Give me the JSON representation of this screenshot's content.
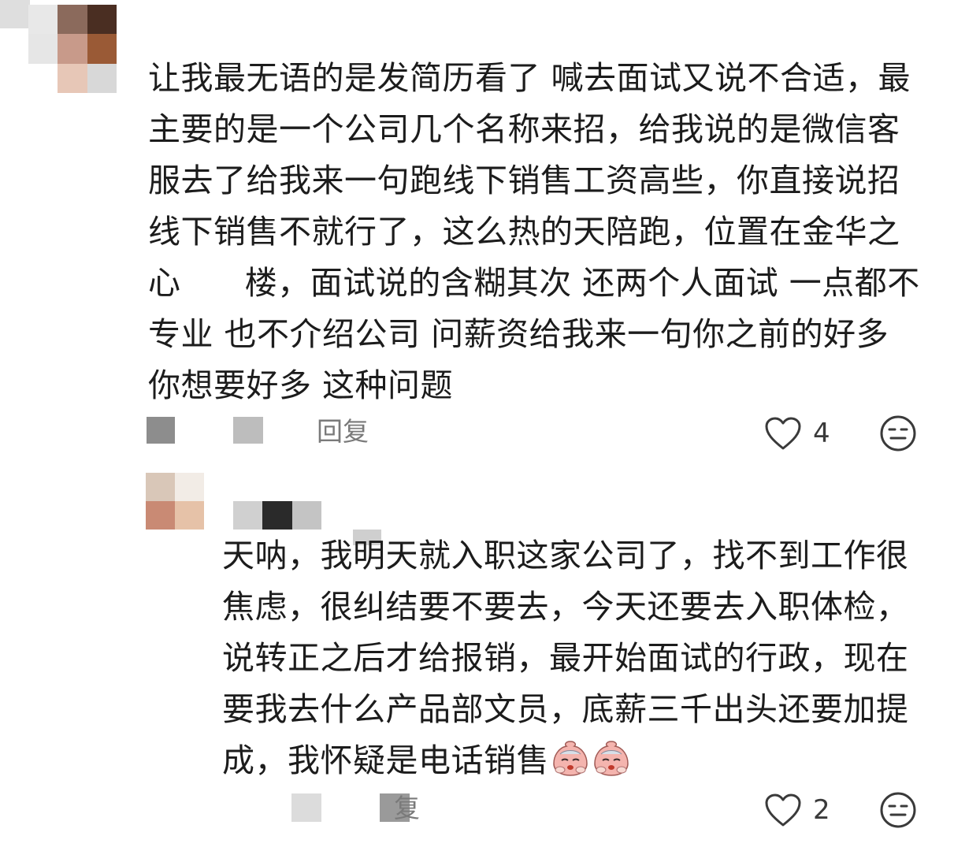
{
  "comment": {
    "text": "让我最无语的是发简历看了 喊去面试又说不合适，最主要的是一个公司几个名称来招，给我说的是微信客服去了给我来一句跑线下销售工资高些，你直接说招线下销售不就行了，这么热的天陪跑，位置在金华之心      楼，面试说的含糊其次 还两个人面试 一点都不专业 也不介绍公司 问薪资给我来一句你之前的好多 你想要好多 这种问题",
    "reply_label": "回复",
    "like_count": "4",
    "avatar_colors": [
      "#e8e8e8",
      "#8b6a5c",
      "#4a2e22",
      "#e6e6e6",
      "#c89a8a",
      "#9a5a36",
      "#ffffff",
      "#e7c7b7",
      "#d8d8d8"
    ]
  },
  "reply": {
    "text": "天呐，我明天就入职这家公司了，找不到工作很焦虑，很纠结要不要去，今天还要去入职体检，说转正之后才给报销，最开始面试的行政，现在要我去什么产品部文员，底薪三千出头还要加提成，我怀疑是电话销售",
    "reply_label": "复",
    "like_count": "2",
    "emojis": [
      "crying-face-emoji",
      "crying-face-emoji"
    ],
    "avatar_colors": [
      "#d9c7b8",
      "#f2ece6",
      "#c98a74",
      "#e6c2a8"
    ],
    "name_colors": [
      "#d0d0d0",
      "#2a2a2a",
      "#c4c4c4"
    ]
  },
  "colors": {
    "text": "#1c1c1c",
    "meta": "#7a7a7a",
    "icon": "#3a3a3a"
  }
}
